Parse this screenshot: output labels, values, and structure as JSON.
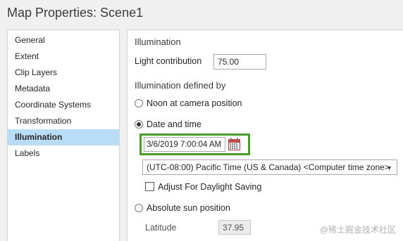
{
  "window": {
    "title": "Map Properties: Scene1"
  },
  "sidebar": {
    "items": [
      {
        "label": "General"
      },
      {
        "label": "Extent"
      },
      {
        "label": "Clip Layers"
      },
      {
        "label": "Metadata"
      },
      {
        "label": "Coordinate Systems"
      },
      {
        "label": "Transformation"
      },
      {
        "label": "Illumination",
        "selected": true
      },
      {
        "label": "Labels"
      }
    ]
  },
  "illumination": {
    "section_title": "Illumination",
    "light_contribution_label": "Light contribution",
    "light_contribution_value": "75.00",
    "defined_by_title": "Illumination defined by",
    "options": {
      "noon": "Noon at camera position",
      "date_time": "Date and time",
      "absolute": "Absolute sun position"
    },
    "selected_option": "date_time",
    "datetime_value": "3/6/2019 7:00:04 AM",
    "calendar_icon": "calendar-icon",
    "timezone_value": "(UTC-08:00) Pacific Time (US & Canada) <Computer time zone>",
    "daylight_saving_label": "Adjust For Daylight Saving",
    "daylight_saving_checked": false,
    "latitude_label": "Latitude",
    "latitude_value": "37.95"
  },
  "colors": {
    "selection": "#b9dcf7",
    "highlight_border": "#4c9a2a"
  },
  "watermark": "@稀土掘金技术社区"
}
